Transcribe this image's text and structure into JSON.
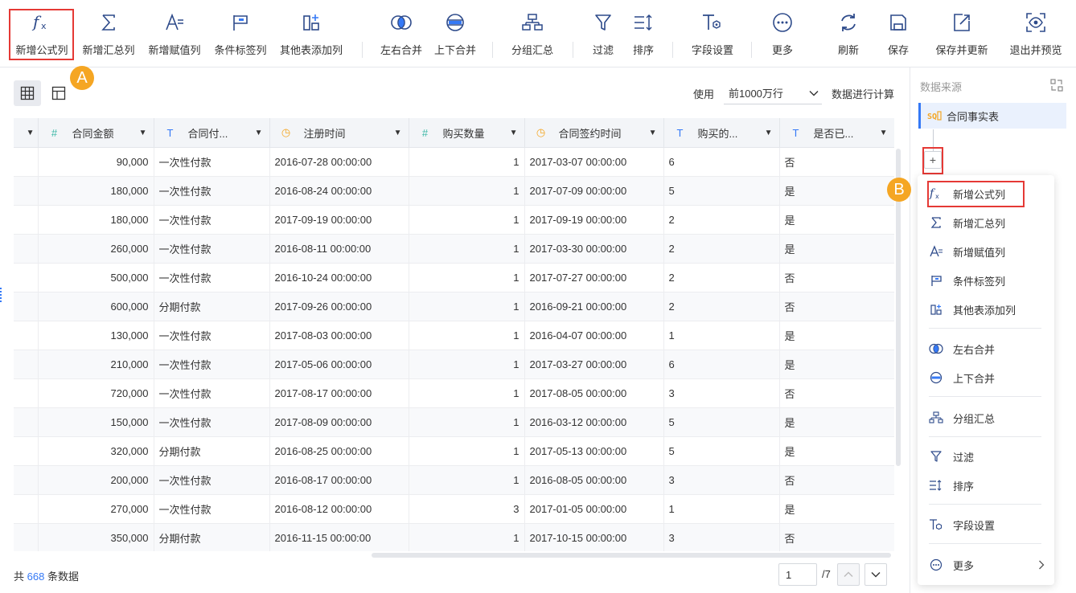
{
  "toolbar": {
    "items": [
      {
        "label": "新增公式列",
        "icon": "formula-icon"
      },
      {
        "label": "新增汇总列",
        "icon": "sigma-icon"
      },
      {
        "label": "新增赋值列",
        "icon": "assign-icon"
      },
      {
        "label": "条件标签列",
        "icon": "flag-icon"
      },
      {
        "label": "其他表添加列",
        "icon": "table-add-icon"
      },
      {
        "label": "左右合并",
        "icon": "merge-horizontal-icon"
      },
      {
        "label": "上下合并",
        "icon": "merge-vertical-icon"
      },
      {
        "label": "分组汇总",
        "icon": "group-icon"
      },
      {
        "label": "过滤",
        "icon": "filter-icon"
      },
      {
        "label": "排序",
        "icon": "sort-icon"
      },
      {
        "label": "字段设置",
        "icon": "field-settings-icon"
      },
      {
        "label": "更多",
        "icon": "more-icon"
      },
      {
        "label": "刷新",
        "icon": "refresh-icon"
      },
      {
        "label": "保存",
        "icon": "save-icon"
      },
      {
        "label": "保存并更新",
        "icon": "save-update-icon"
      },
      {
        "label": "退出并预览",
        "icon": "preview-icon"
      }
    ]
  },
  "annotations": {
    "a": "A",
    "b": "B"
  },
  "calc": {
    "prefix": "使用",
    "selected": "前1000万行",
    "suffix": "数据进行计算"
  },
  "table": {
    "columns": [
      {
        "name": "",
        "type": "none"
      },
      {
        "name": "合同金额",
        "type": "number"
      },
      {
        "name": "合同付...",
        "type": "text"
      },
      {
        "name": "注册时间",
        "type": "date"
      },
      {
        "name": "购买数量",
        "type": "number"
      },
      {
        "name": "合同签约时间",
        "type": "date"
      },
      {
        "name": "购买的...",
        "type": "text"
      },
      {
        "name": "是否已...",
        "type": "text"
      }
    ],
    "rows": [
      [
        "",
        "90,000",
        "一次性付款",
        "2016-07-28 00:00:00",
        "1",
        "2017-03-07 00:00:00",
        "6",
        "否"
      ],
      [
        "",
        "180,000",
        "一次性付款",
        "2016-08-24 00:00:00",
        "1",
        "2017-07-09 00:00:00",
        "5",
        "是"
      ],
      [
        "",
        "180,000",
        "一次性付款",
        "2017-09-19 00:00:00",
        "1",
        "2017-09-19 00:00:00",
        "2",
        "是"
      ],
      [
        "",
        "260,000",
        "一次性付款",
        "2016-08-11 00:00:00",
        "1",
        "2017-03-30 00:00:00",
        "2",
        "是"
      ],
      [
        "",
        "500,000",
        "一次性付款",
        "2016-10-24 00:00:00",
        "1",
        "2017-07-27 00:00:00",
        "2",
        "否"
      ],
      [
        "",
        "600,000",
        "分期付款",
        "2017-09-26 00:00:00",
        "1",
        "2016-09-21 00:00:00",
        "2",
        "否"
      ],
      [
        "",
        "130,000",
        "一次性付款",
        "2017-08-03 00:00:00",
        "1",
        "2016-04-07 00:00:00",
        "1",
        "是"
      ],
      [
        "",
        "210,000",
        "一次性付款",
        "2017-05-06 00:00:00",
        "1",
        "2017-03-27 00:00:00",
        "6",
        "是"
      ],
      [
        "",
        "720,000",
        "一次性付款",
        "2017-08-17 00:00:00",
        "1",
        "2017-08-05 00:00:00",
        "3",
        "否"
      ],
      [
        "",
        "150,000",
        "一次性付款",
        "2017-08-09 00:00:00",
        "1",
        "2016-03-12 00:00:00",
        "5",
        "是"
      ],
      [
        "",
        "320,000",
        "分期付款",
        "2016-08-25 00:00:00",
        "1",
        "2017-05-13 00:00:00",
        "5",
        "是"
      ],
      [
        "",
        "200,000",
        "一次性付款",
        "2016-08-17 00:00:00",
        "1",
        "2016-08-05 00:00:00",
        "3",
        "否"
      ],
      [
        "",
        "270,000",
        "一次性付款",
        "2016-08-12 00:00:00",
        "3",
        "2017-01-05 00:00:00",
        "1",
        "是"
      ],
      [
        "",
        "350,000",
        "分期付款",
        "2016-11-15 00:00:00",
        "1",
        "2017-10-15 00:00:00",
        "3",
        "否"
      ]
    ]
  },
  "footer": {
    "prefix": "共",
    "count": "668",
    "suffix": "条数据",
    "page": "1",
    "total_pages": "/7"
  },
  "right_panel": {
    "title": "数据来源",
    "source": "合同事实表",
    "plus": "+"
  },
  "menu": {
    "groups": [
      [
        {
          "label": "新增公式列",
          "icon": "formula-icon"
        },
        {
          "label": "新增汇总列",
          "icon": "sigma-icon"
        },
        {
          "label": "新增赋值列",
          "icon": "assign-icon"
        },
        {
          "label": "条件标签列",
          "icon": "flag-icon"
        },
        {
          "label": "其他表添加列",
          "icon": "table-add-icon"
        }
      ],
      [
        {
          "label": "左右合并",
          "icon": "merge-horizontal-icon"
        },
        {
          "label": "上下合并",
          "icon": "merge-vertical-icon"
        }
      ],
      [
        {
          "label": "分组汇总",
          "icon": "group-icon"
        }
      ],
      [
        {
          "label": "过滤",
          "icon": "filter-icon"
        },
        {
          "label": "排序",
          "icon": "sort-icon"
        }
      ],
      [
        {
          "label": "字段设置",
          "icon": "field-settings-icon"
        }
      ],
      [
        {
          "label": "更多",
          "icon": "more-icon"
        }
      ]
    ]
  },
  "colors": {
    "accent": "#3579f6",
    "highlight": "#e53935",
    "badge": "#f5a623",
    "number_type": "#3cb8a6"
  }
}
